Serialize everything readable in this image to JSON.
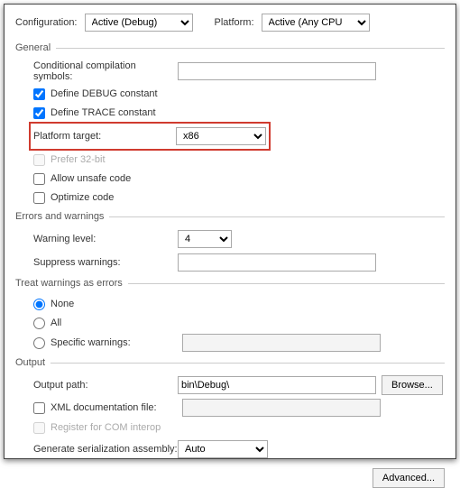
{
  "top": {
    "config_label": "Configuration:",
    "config_value": "Active (Debug)",
    "platform_label": "Platform:",
    "platform_value": "Active (Any CPU)"
  },
  "groups": {
    "general": "General",
    "errors": "Errors and warnings",
    "treat": "Treat warnings as errors",
    "output": "Output"
  },
  "general": {
    "cond_label": "Conditional compilation symbols:",
    "cond_value": "",
    "define_debug": "Define DEBUG constant",
    "define_trace": "Define TRACE constant",
    "platform_target_label": "Platform target:",
    "platform_target_value": "x86",
    "prefer32": "Prefer 32-bit",
    "allow_unsafe": "Allow unsafe code",
    "optimize": "Optimize code"
  },
  "errors": {
    "warning_level_label": "Warning level:",
    "warning_level_value": "4",
    "suppress_label": "Suppress warnings:",
    "suppress_value": ""
  },
  "treat": {
    "none": "None",
    "all": "All",
    "specific": "Specific warnings:",
    "specific_value": ""
  },
  "output": {
    "path_label": "Output path:",
    "path_value": "bin\\Debug\\",
    "browse": "Browse...",
    "xml_doc": "XML documentation file:",
    "xml_value": "",
    "register_com": "Register for COM interop",
    "gen_label": "Generate serialization assembly:",
    "gen_value": "Auto"
  },
  "advanced": "Advanced..."
}
